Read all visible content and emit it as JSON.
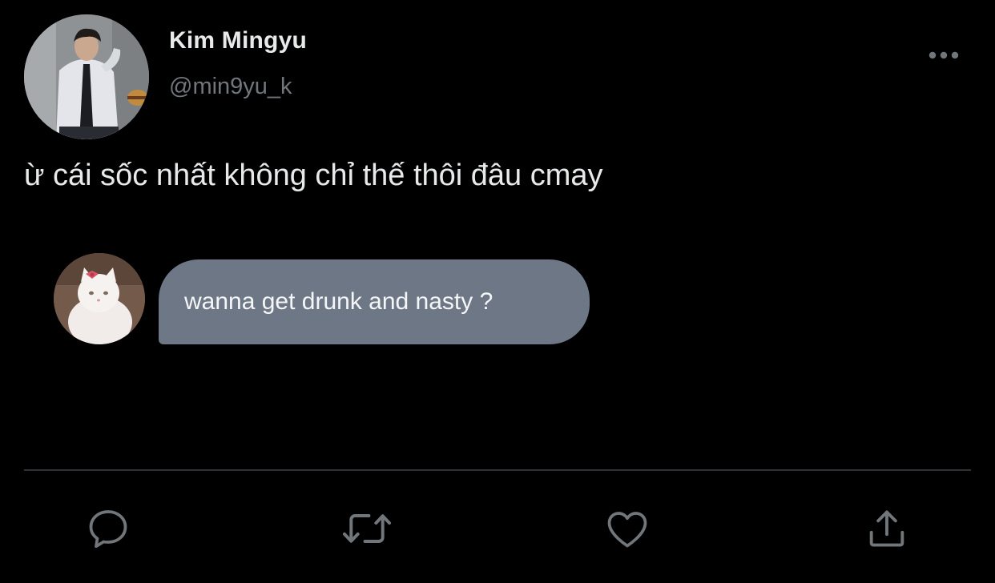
{
  "author": {
    "display_name": "Kim Mingyu",
    "handle": "@min9yu_k"
  },
  "tweet": {
    "text": "ừ cái sốc nhất không chỉ thế thôi đâu cmay"
  },
  "embedded_message": {
    "text": "wanna get drunk and nasty ?",
    "bubble_color": "#6d7785"
  },
  "actions": {
    "reply_icon": "reply-icon",
    "retweet_icon": "retweet-icon",
    "like_icon": "heart-icon",
    "share_icon": "share-icon",
    "more_icon": "more-horizontal-icon"
  },
  "colors": {
    "background": "#000000",
    "primary_text": "#e7e9ea",
    "secondary_text": "#71767b",
    "divider": "#2f3336"
  }
}
